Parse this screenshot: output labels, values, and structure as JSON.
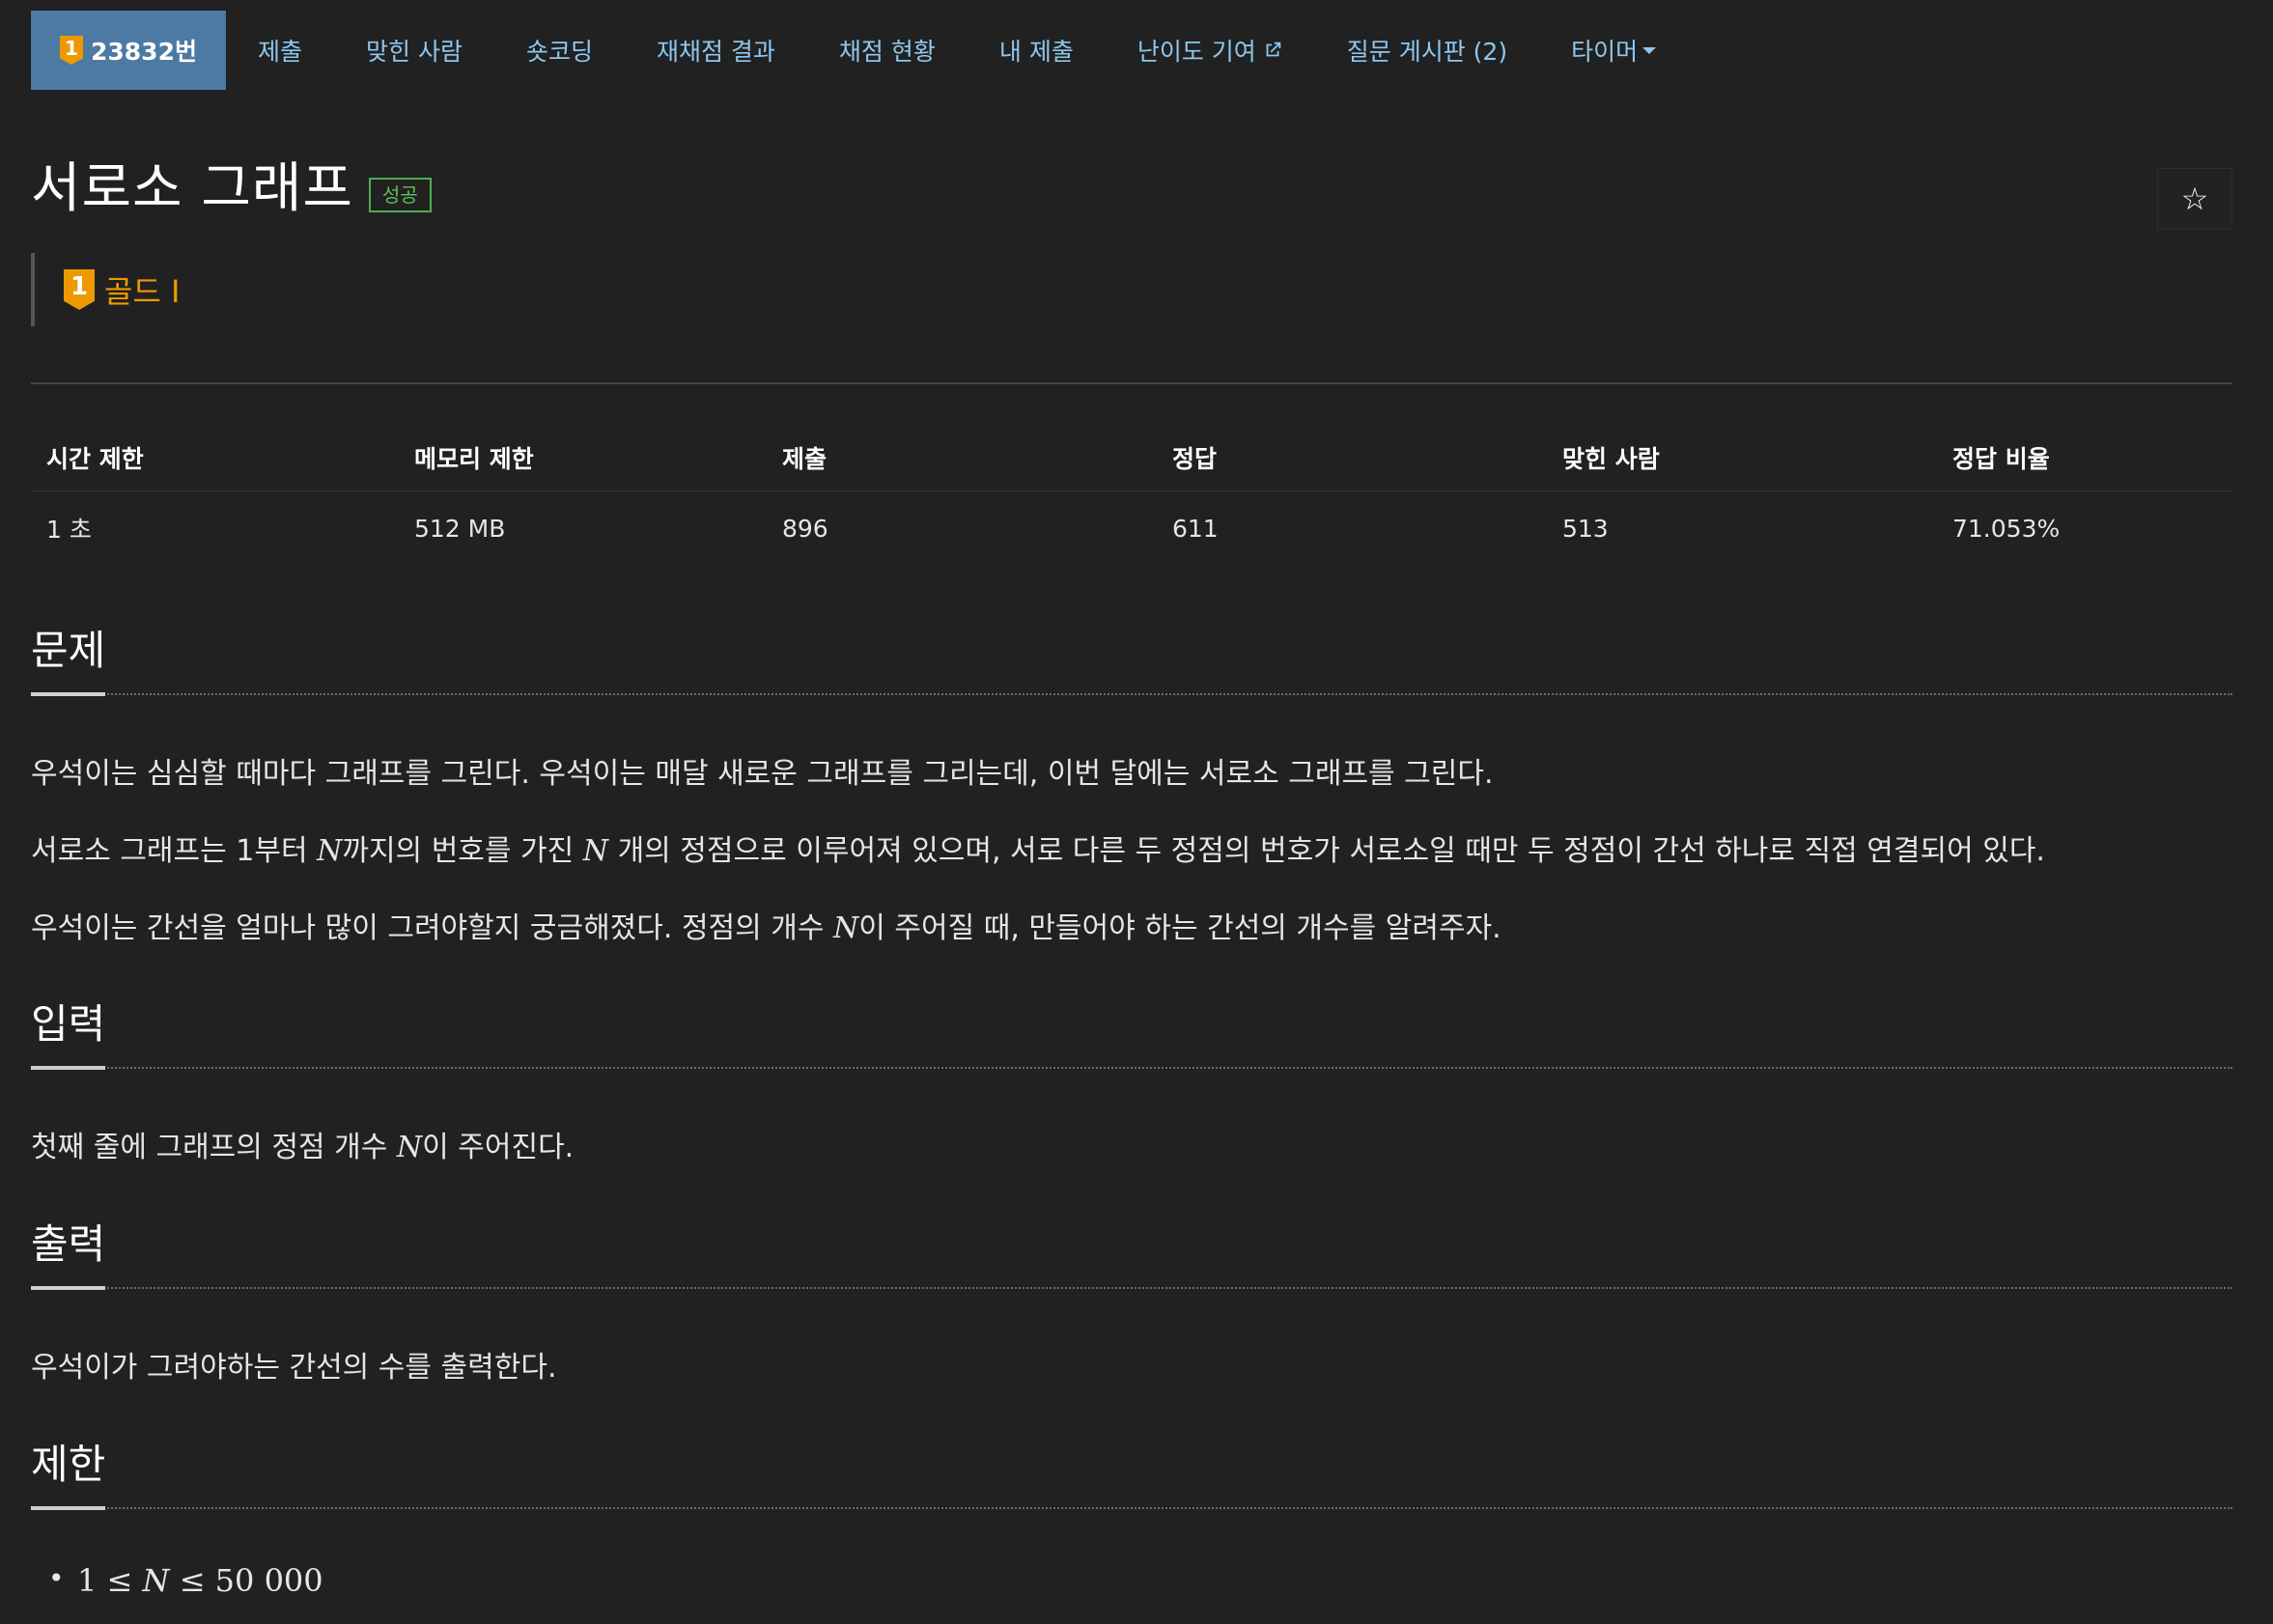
{
  "nav": {
    "problem_id": "23832번",
    "tier_number": "1",
    "tabs": [
      "제출",
      "맞힌 사람",
      "숏코딩",
      "재채점 결과",
      "채점 현황",
      "내 제출"
    ],
    "difficulty": "난이도 기여",
    "qna": "질문 게시판 (2)",
    "timer": "타이머"
  },
  "problem": {
    "title": "서로소 그래프",
    "status": "성공",
    "star": "☆",
    "tier_number": "1",
    "tier_label": "골드 I"
  },
  "info": {
    "headers": [
      "시간 제한",
      "메모리 제한",
      "제출",
      "정답",
      "맞힌 사람",
      "정답 비율"
    ],
    "values": [
      "1 초",
      "512 MB",
      "896",
      "611",
      "513",
      "71.053%"
    ]
  },
  "sections": {
    "problem": {
      "title": "문제",
      "p1": "우석이는 심심할 때마다 그래프를 그린다. 우석이는 매달 새로운 그래프를 그리는데, 이번 달에는 서로소 그래프를 그린다.",
      "p2a": "서로소 그래프는 1부터 ",
      "p2_n1": "N",
      "p2b": "까지의 번호를 가진 ",
      "p2_n2": "N",
      "p2c": " 개의 정점으로 이루어져 있으며, 서로 다른 두 정점의 번호가 서로소일 때만 두 정점이 간선 하나로 직접 연결되어 있다.",
      "p3a": "우석이는 간선을 얼마나 많이 그려야할지 궁금해졌다. 정점의 개수 ",
      "p3_n": "N",
      "p3b": "이 주어질 때, 만들어야 하는 간선의 개수를 알려주자."
    },
    "input": {
      "title": "입력",
      "p1a": "첫째 줄에 그래프의 정점 개수 ",
      "p1_n": "N",
      "p1b": "이 주어진다."
    },
    "output": {
      "title": "출력",
      "p1": "우석이가 그려야하는 간선의 수를 출력한다."
    },
    "limit": {
      "title": "제한",
      "lo": "1",
      "le1": " ≤ ",
      "n": "N",
      "le2": " ≤ ",
      "hi": "50 000"
    }
  }
}
